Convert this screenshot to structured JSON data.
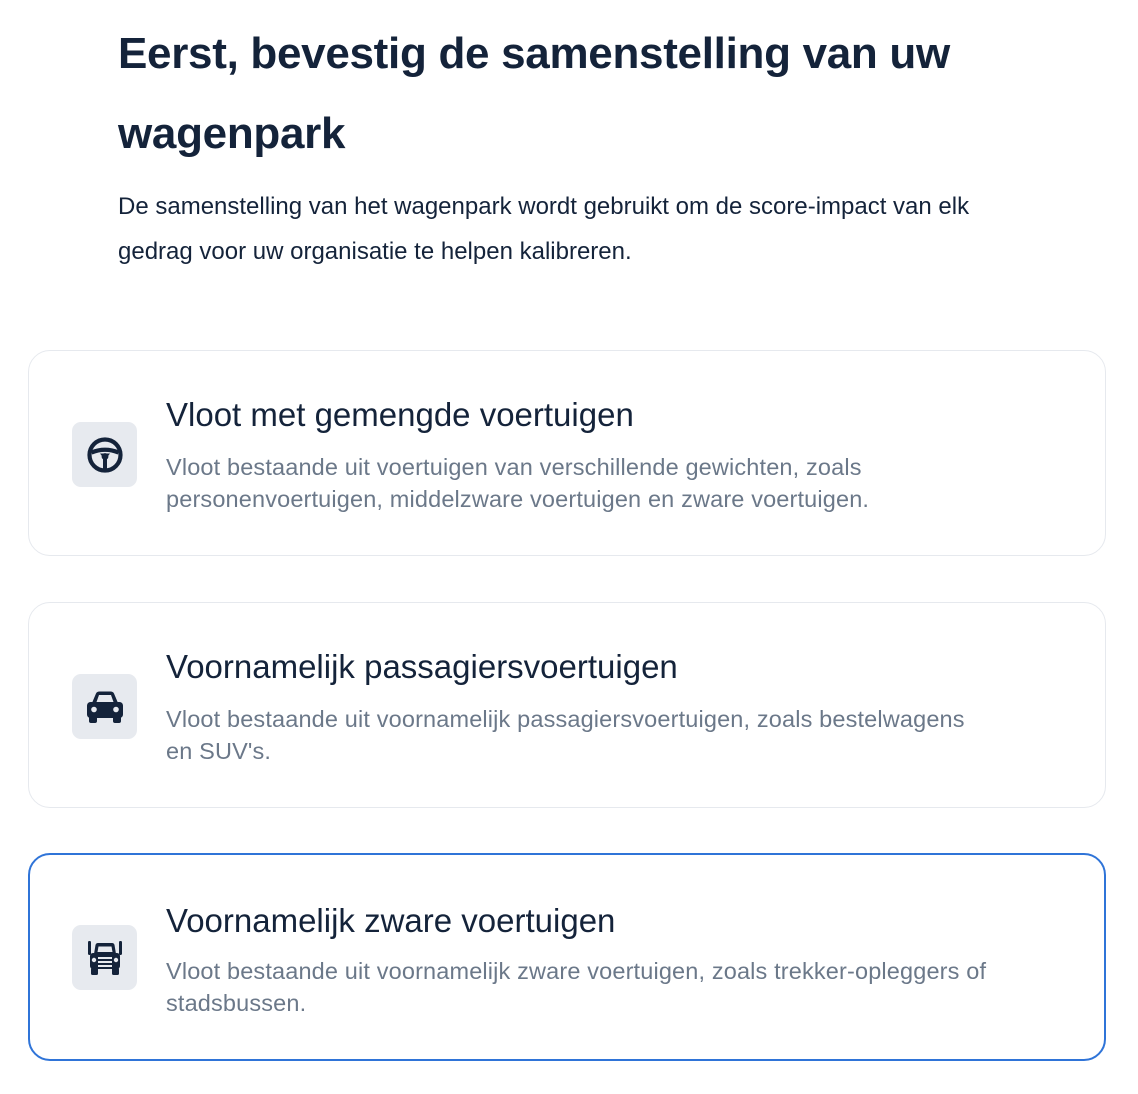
{
  "header": {
    "title": "Eerst, bevestig de samenstelling van uw wagenpark",
    "subtitle": "De samenstelling van het wagenpark wordt gebruikt om de score-impact van elk gedrag voor uw organisatie te helpen kalibreren."
  },
  "options": [
    {
      "title": "Vloot met gemengde voertuigen",
      "description": "Vloot bestaande uit voertuigen van verschillende gewichten, zoals personenvoertuigen, middelzware voertuigen en zware voertuigen.",
      "icon": "steering-wheel-icon",
      "selected": false
    },
    {
      "title": "Voornamelijk passagiersvoertuigen",
      "description": "Vloot bestaande uit voornamelijk passagiersvoertuigen, zoals bestelwagens en SUV's.",
      "icon": "car-icon",
      "selected": false
    },
    {
      "title": "Voornamelijk zware voertuigen",
      "description": "Vloot bestaande uit voornamelijk zware voertuigen, zoals trekker-opleggers of stadsbussen.",
      "icon": "truck-icon",
      "selected": true
    }
  ],
  "colors": {
    "text_primary": "#14233a",
    "text_secondary": "#6b7889",
    "card_border": "#e6e9ee",
    "selected_border": "#2f74d8",
    "icon_bg": "#e7eaef"
  }
}
